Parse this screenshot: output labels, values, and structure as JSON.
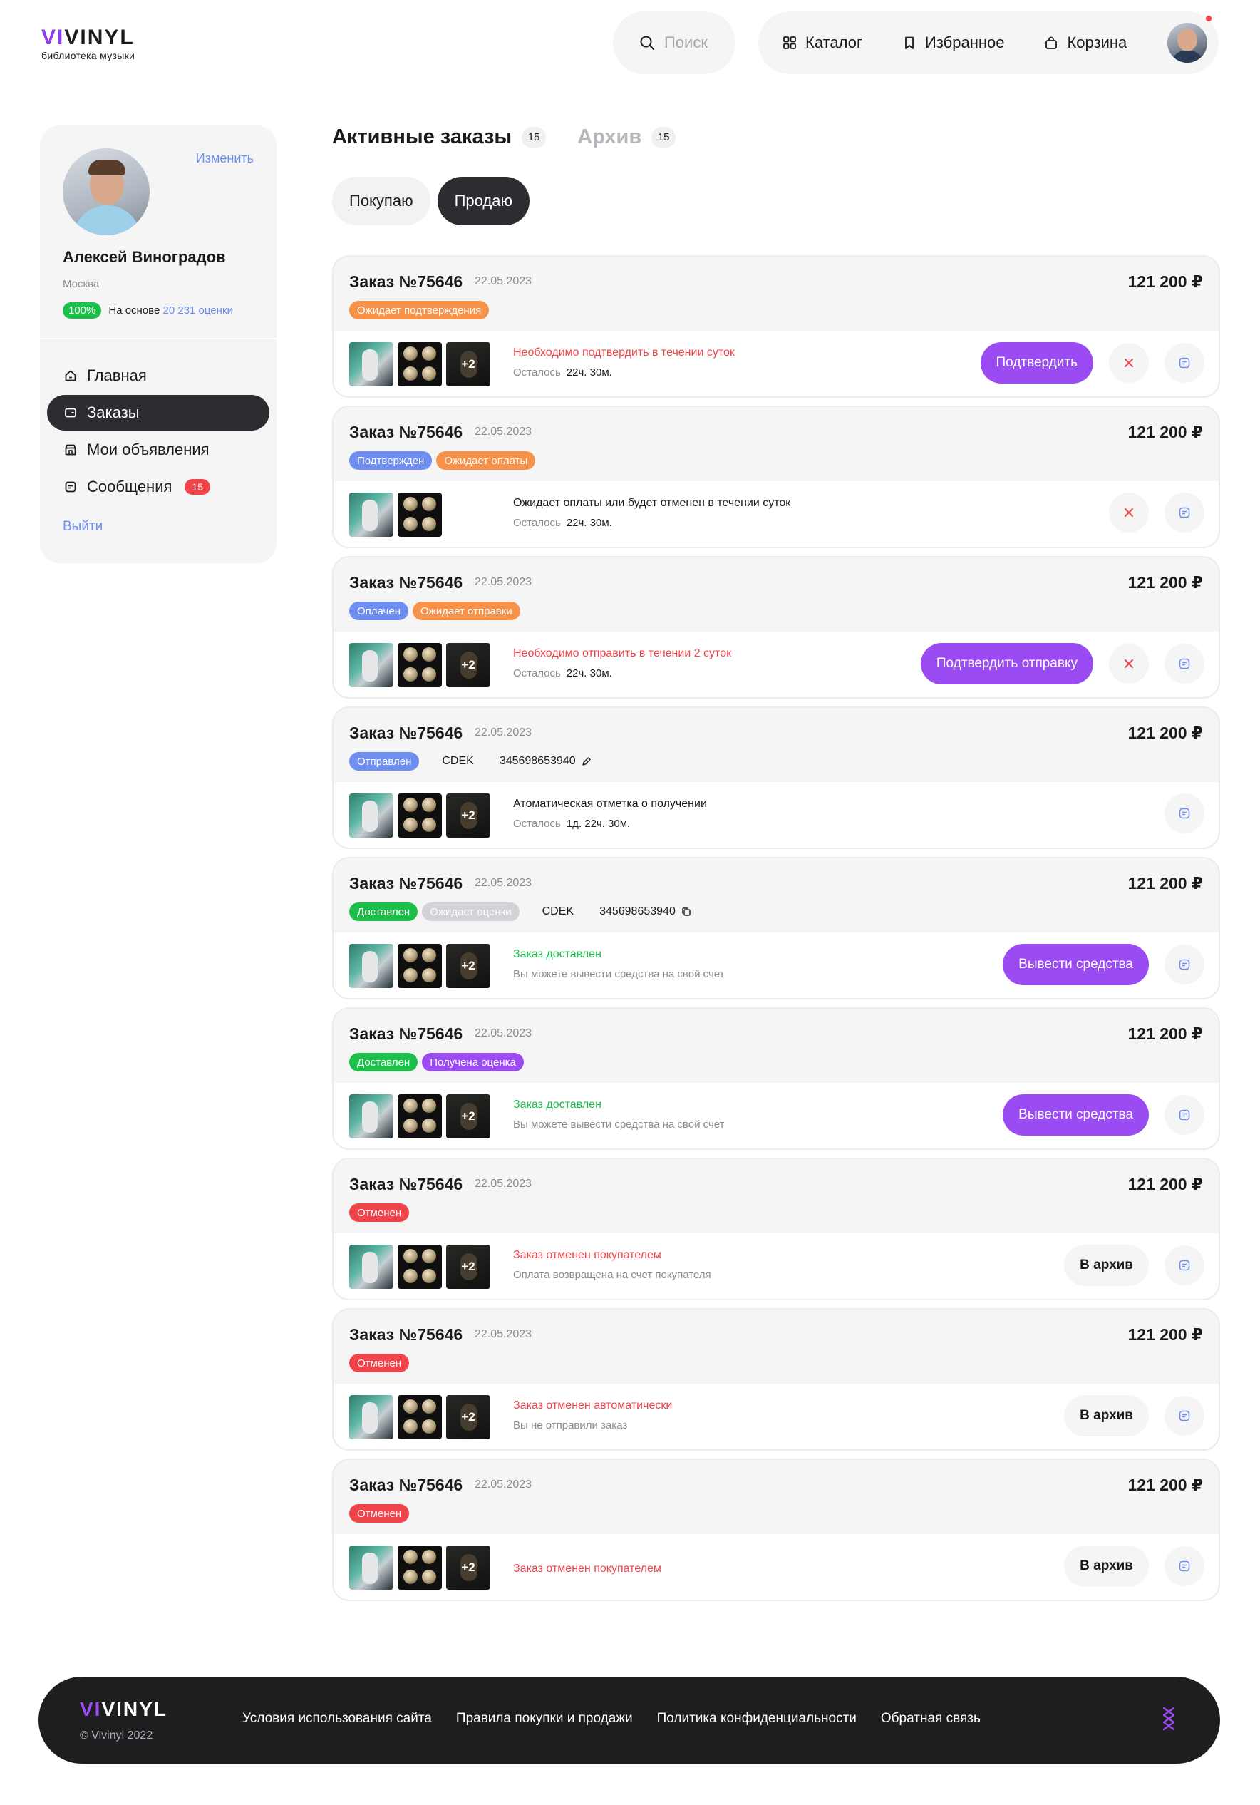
{
  "header": {
    "logo_vi": "VI",
    "logo_vinyl": "VINYL",
    "logo_sub": "библиотека музыки",
    "search_placeholder": "Поиск",
    "nav": [
      {
        "label": "Каталог",
        "icon": "grid-icon"
      },
      {
        "label": "Избранное",
        "icon": "bookmark-icon"
      },
      {
        "label": "Корзина",
        "icon": "bag-icon"
      }
    ]
  },
  "profile": {
    "edit": "Изменить",
    "name": "Алексей Виноградов",
    "city": "Москва",
    "rating_percent": "100%",
    "rating_prefix": "На основе",
    "rating_link": "20 231 оценки"
  },
  "menu": {
    "items": [
      {
        "label": "Главная",
        "icon": "home-icon"
      },
      {
        "label": "Заказы",
        "icon": "wallet-icon"
      },
      {
        "label": "Мои объявления",
        "icon": "shop-icon"
      },
      {
        "label": "Сообщения",
        "icon": "message-icon",
        "badge": "15"
      }
    ],
    "logout": "Выйти"
  },
  "tabs": [
    {
      "label": "Активные заказы",
      "count": "15"
    },
    {
      "label": "Архив",
      "count": "15"
    }
  ],
  "segments": [
    "Покупаю",
    "Продаю"
  ],
  "orders": [
    {
      "title": "Заказ №75646",
      "date": "22.05.2023",
      "price": "121 200 ₽",
      "tags": [
        {
          "label": "Ожидает подтверждения",
          "color": "#f6924a"
        }
      ],
      "info_main": "Необходимо подтвердить в течении суток",
      "info_sub_label": "Осталось",
      "info_sub_value": "22ч. 30м.",
      "button": "Подтвердить"
    },
    {
      "title": "Заказ №75646",
      "date": "22.05.2023",
      "price": "121 200 ₽",
      "tags": [
        {
          "label": "Подтвержден",
          "color": "#6f8ef2"
        },
        {
          "label": "Ожидает оплаты",
          "color": "#f6924a"
        }
      ],
      "info_main": "Ожидает оплаты или будет отменен в течении суток",
      "info_sub_label": "Осталось",
      "info_sub_value": "22ч. 30м."
    },
    {
      "title": "Заказ №75646",
      "date": "22.05.2023",
      "price": "121 200 ₽",
      "tags": [
        {
          "label": "Оплачен",
          "color": "#6f8ef2"
        },
        {
          "label": "Ожидает отправки",
          "color": "#f6924a"
        }
      ],
      "info_main": "Необходимо отправить в течении 2 суток",
      "info_sub_label": "Осталось",
      "info_sub_value": "22ч. 30м.",
      "button": "Подтвердить отправку"
    },
    {
      "title": "Заказ №75646",
      "date": "22.05.2023",
      "price": "121 200 ₽",
      "tags": [
        {
          "label": "Отправлен",
          "color": "#6f8ef2"
        }
      ],
      "carrier": "CDEK",
      "tracking": "345698653940",
      "info_main": "Атоматическая отметка о получении",
      "info_sub_label": "Осталось",
      "info_sub_value": "1д. 22ч. 30м."
    },
    {
      "title": "Заказ №75646",
      "date": "22.05.2023",
      "price": "121 200 ₽",
      "tags": [
        {
          "label": "Доставлен",
          "color": "#1dbf4b"
        },
        {
          "label": "Ожидает оценки",
          "color": "#d3d3d7"
        }
      ],
      "carrier": "CDEK",
      "tracking": "345698653940",
      "info_main": "Заказ доставлен",
      "info_sub_text": "Вы можете вывести средства на свой счет",
      "button": "Вывести средства"
    },
    {
      "title": "Заказ №75646",
      "date": "22.05.2023",
      "price": "121 200 ₽",
      "tags": [
        {
          "label": "Доставлен",
          "color": "#1dbf4b"
        },
        {
          "label": "Получена оценка",
          "color": "#9a4cf2"
        }
      ],
      "info_main": "Заказ доставлен",
      "info_sub_text": "Вы можете вывести средства на свой счет",
      "button": "Вывести средства"
    },
    {
      "title": "Заказ №75646",
      "date": "22.05.2023",
      "price": "121 200 ₽",
      "tags": [
        {
          "label": "Отменен",
          "color": "#f0434a"
        }
      ],
      "info_main": "Заказ отменен покупателем",
      "info_sub_text": "Оплата возвращена на счет покупателя",
      "archive": "В архив"
    },
    {
      "title": "Заказ №75646",
      "date": "22.05.2023",
      "price": "121 200 ₽",
      "tags": [
        {
          "label": "Отменен",
          "color": "#f0434a"
        }
      ],
      "info_main": "Заказ отменен автоматически",
      "info_sub_text": "Вы не отправили заказ",
      "archive": "В архив"
    },
    {
      "title": "Заказ №75646",
      "date": "22.05.2023",
      "price": "121 200 ₽",
      "tags": [
        {
          "label": "Отменен",
          "color": "#f0434a"
        }
      ],
      "info_main": "Заказ отменен покупателем",
      "archive": "В архив"
    }
  ],
  "thumb_plus": "+2",
  "footer": {
    "logo_vi": "VI",
    "logo_vinyl": "VINYL",
    "copyright": "© Vivinyl 2022",
    "links": [
      "Условия использования сайта",
      "Правила покупки и продажи",
      "Политика конфиденциальности",
      "Обратная связь"
    ]
  }
}
